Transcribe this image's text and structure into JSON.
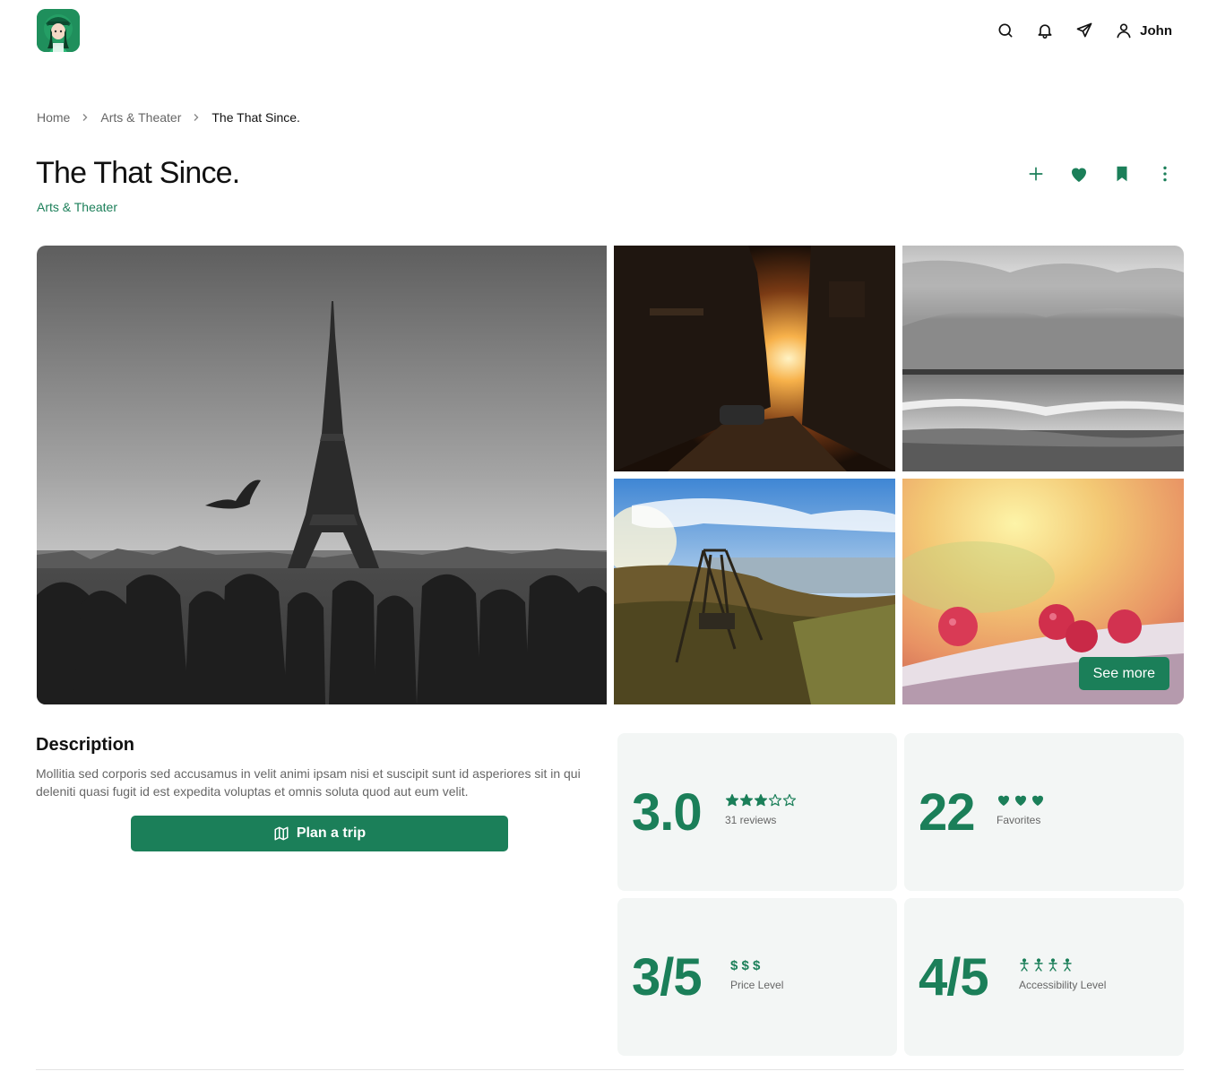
{
  "app": {
    "logo_icon": "avatar-logo-icon",
    "accent_color": "#1b7f59"
  },
  "header": {
    "icons": [
      "search-icon",
      "bell-icon",
      "send-icon",
      "user-icon"
    ],
    "user_name": "John"
  },
  "breadcrumb": {
    "items": [
      {
        "label": "Home"
      },
      {
        "label": "Arts & Theater"
      },
      {
        "label": "The That Since."
      }
    ]
  },
  "page": {
    "title": "The That Since.",
    "category": "Arts & Theater",
    "actions": [
      "plus-icon",
      "heart-icon",
      "bookmark-icon",
      "more-vertical-icon"
    ]
  },
  "gallery": {
    "see_more_label": "See more"
  },
  "description": {
    "heading": "Description",
    "text": "Mollitia sed corporis sed accusamus in velit animi ipsam nisi et suscipit sunt id asperiores sit in qui deleniti quasi fugit id est expedita voluptas et omnis soluta quod aut eum velit.",
    "plan_button_label": "Plan a trip"
  },
  "stats": {
    "rating": {
      "value": "3.0",
      "stars_filled": 3,
      "stars_total": 5,
      "label": "31 reviews"
    },
    "favorites": {
      "value": "22",
      "hearts": 3,
      "label": "Favorites"
    },
    "price": {
      "value": "3/5",
      "symbols": "$ $ $",
      "label": "Price Level"
    },
    "accessibility": {
      "value": "4/5",
      "symbols": "Ὣ6",
      "count": 4,
      "label": "Accessibility Level"
    }
  }
}
